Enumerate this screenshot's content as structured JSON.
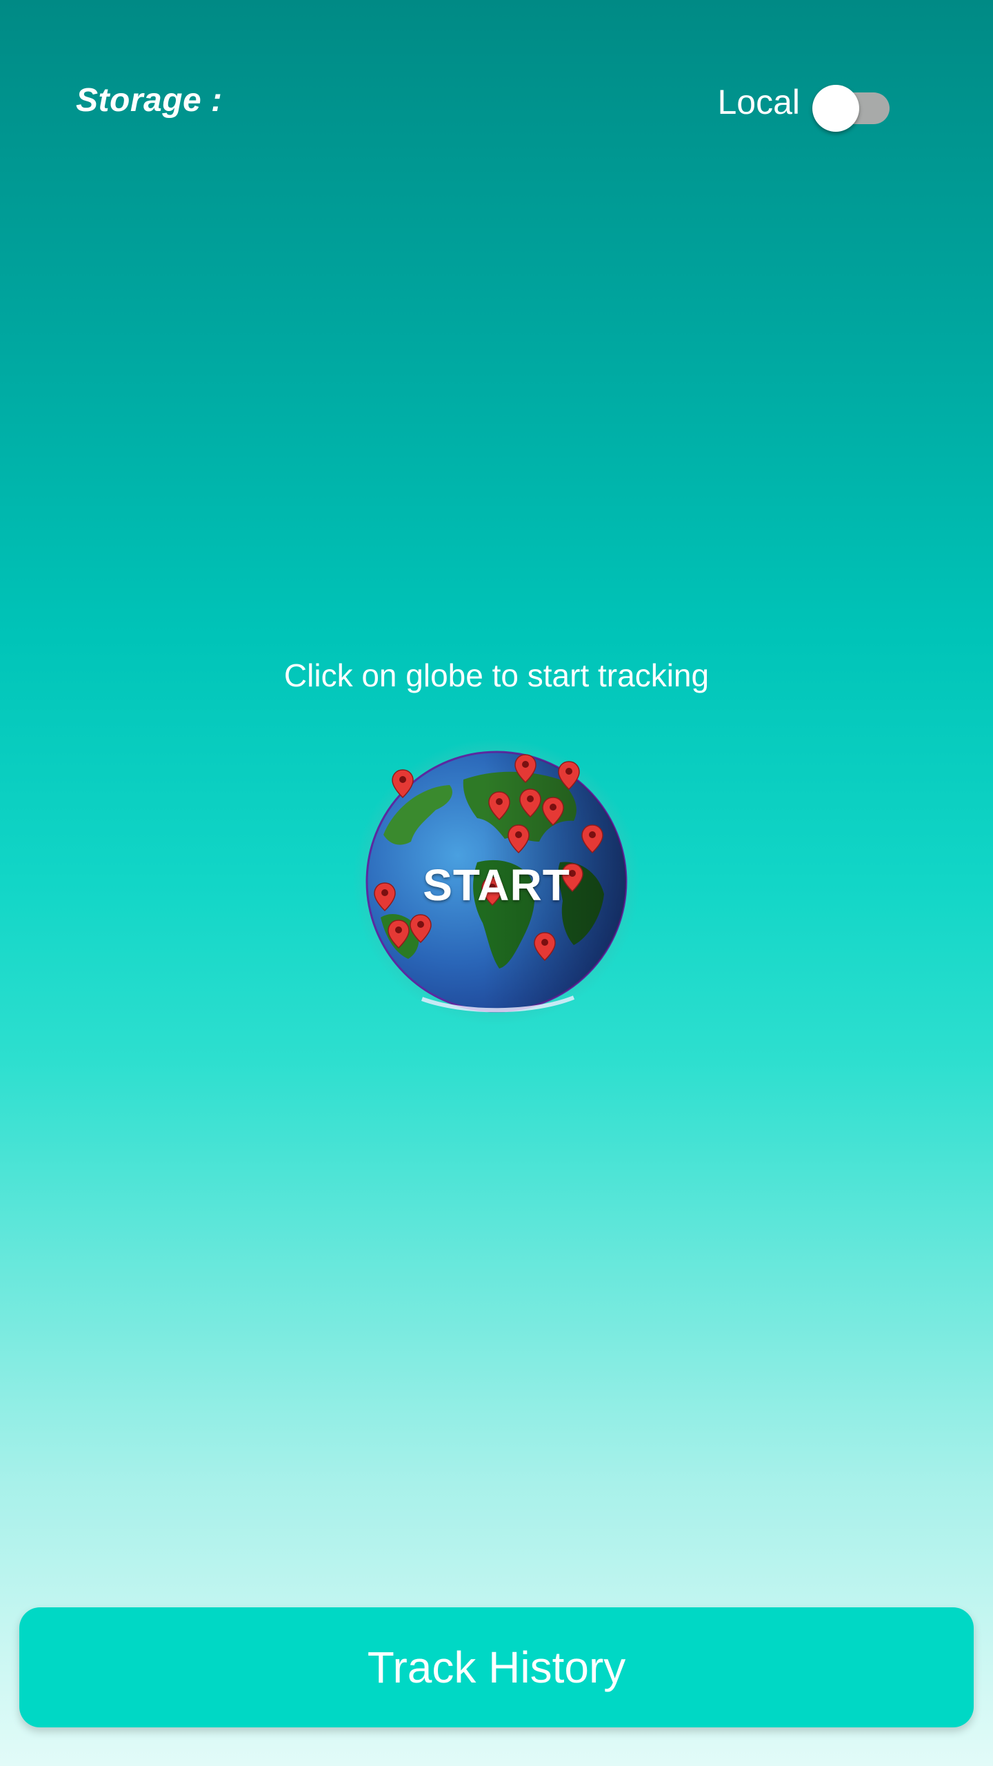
{
  "header": {
    "storage_label": "Storage :",
    "toggle_label": "Local",
    "toggle_on": false
  },
  "main": {
    "instruction": "Click on globe to start tracking",
    "start_label": "START",
    "globe_icon": "globe-with-location-pins-icon"
  },
  "footer": {
    "track_history_label": "Track History"
  },
  "colors": {
    "accent": "#00d8c5",
    "pin": "#e53935"
  }
}
